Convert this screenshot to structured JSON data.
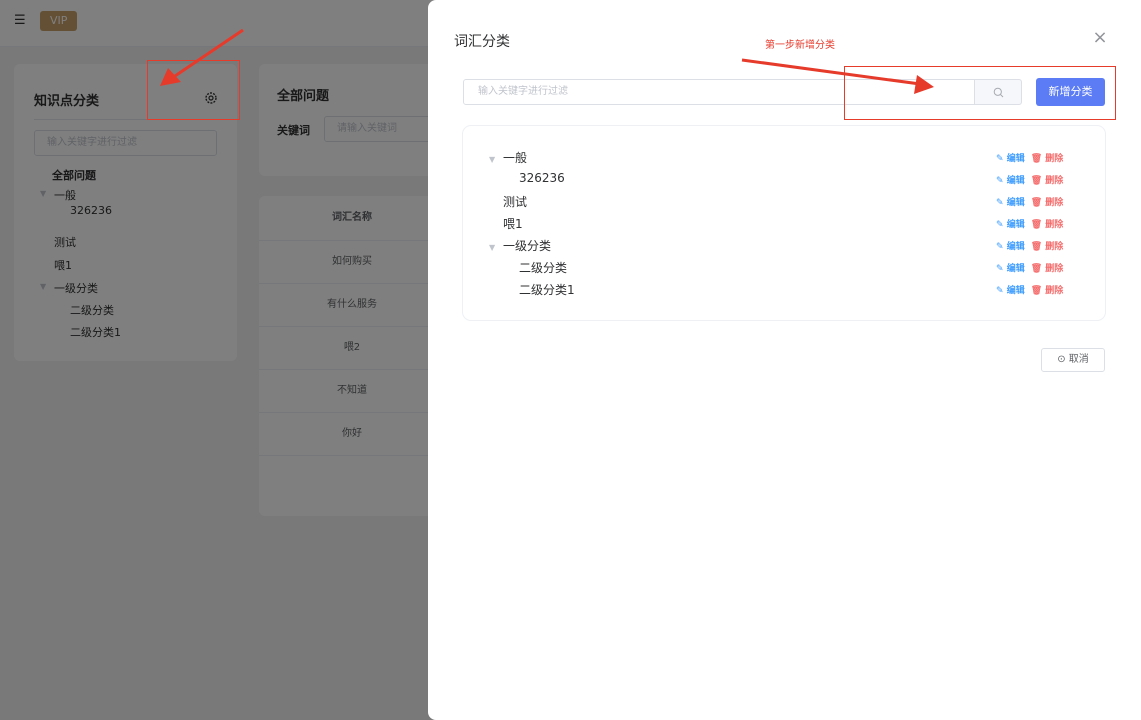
{
  "header": {
    "vip": "VIP"
  },
  "left_panel": {
    "title": "知识点分类",
    "filter_placeholder": "输入关键字进行过滤",
    "tree": [
      {
        "label": "全部问题",
        "bold": true
      },
      {
        "label": "一般",
        "caret": true
      },
      {
        "label": "326236"
      },
      {
        "label": "测试"
      },
      {
        "label": "喂1"
      },
      {
        "label": "一级分类",
        "caret": true
      },
      {
        "label": "二级分类"
      },
      {
        "label": "二级分类1"
      }
    ]
  },
  "main": {
    "title": "全部问题",
    "keyword_label": "关键词",
    "keyword_placeholder": "请输入关键词",
    "table_header": "词汇名称",
    "rows": [
      "如何购买",
      "有什么服务",
      "喂2",
      "不知道",
      "你好"
    ]
  },
  "drawer": {
    "title": "词汇分类",
    "annotation": "第一步新增分类",
    "filter_placeholder": "输入关键字进行过滤",
    "add_button": "新增分类",
    "tree": [
      {
        "label": "一般",
        "caret": true
      },
      {
        "label": "326236"
      },
      {
        "label": "测试"
      },
      {
        "label": "喂1"
      },
      {
        "label": "一级分类",
        "caret": true
      },
      {
        "label": "二级分类"
      },
      {
        "label": "二级分类1"
      }
    ],
    "edit_label": "编辑",
    "delete_label": "删除",
    "cancel_button": "取消"
  },
  "colors": {
    "primary": "#5b7cf4",
    "danger": "#f56c6c",
    "annotation": "#e63a2b",
    "vip": "#c8a06a"
  }
}
